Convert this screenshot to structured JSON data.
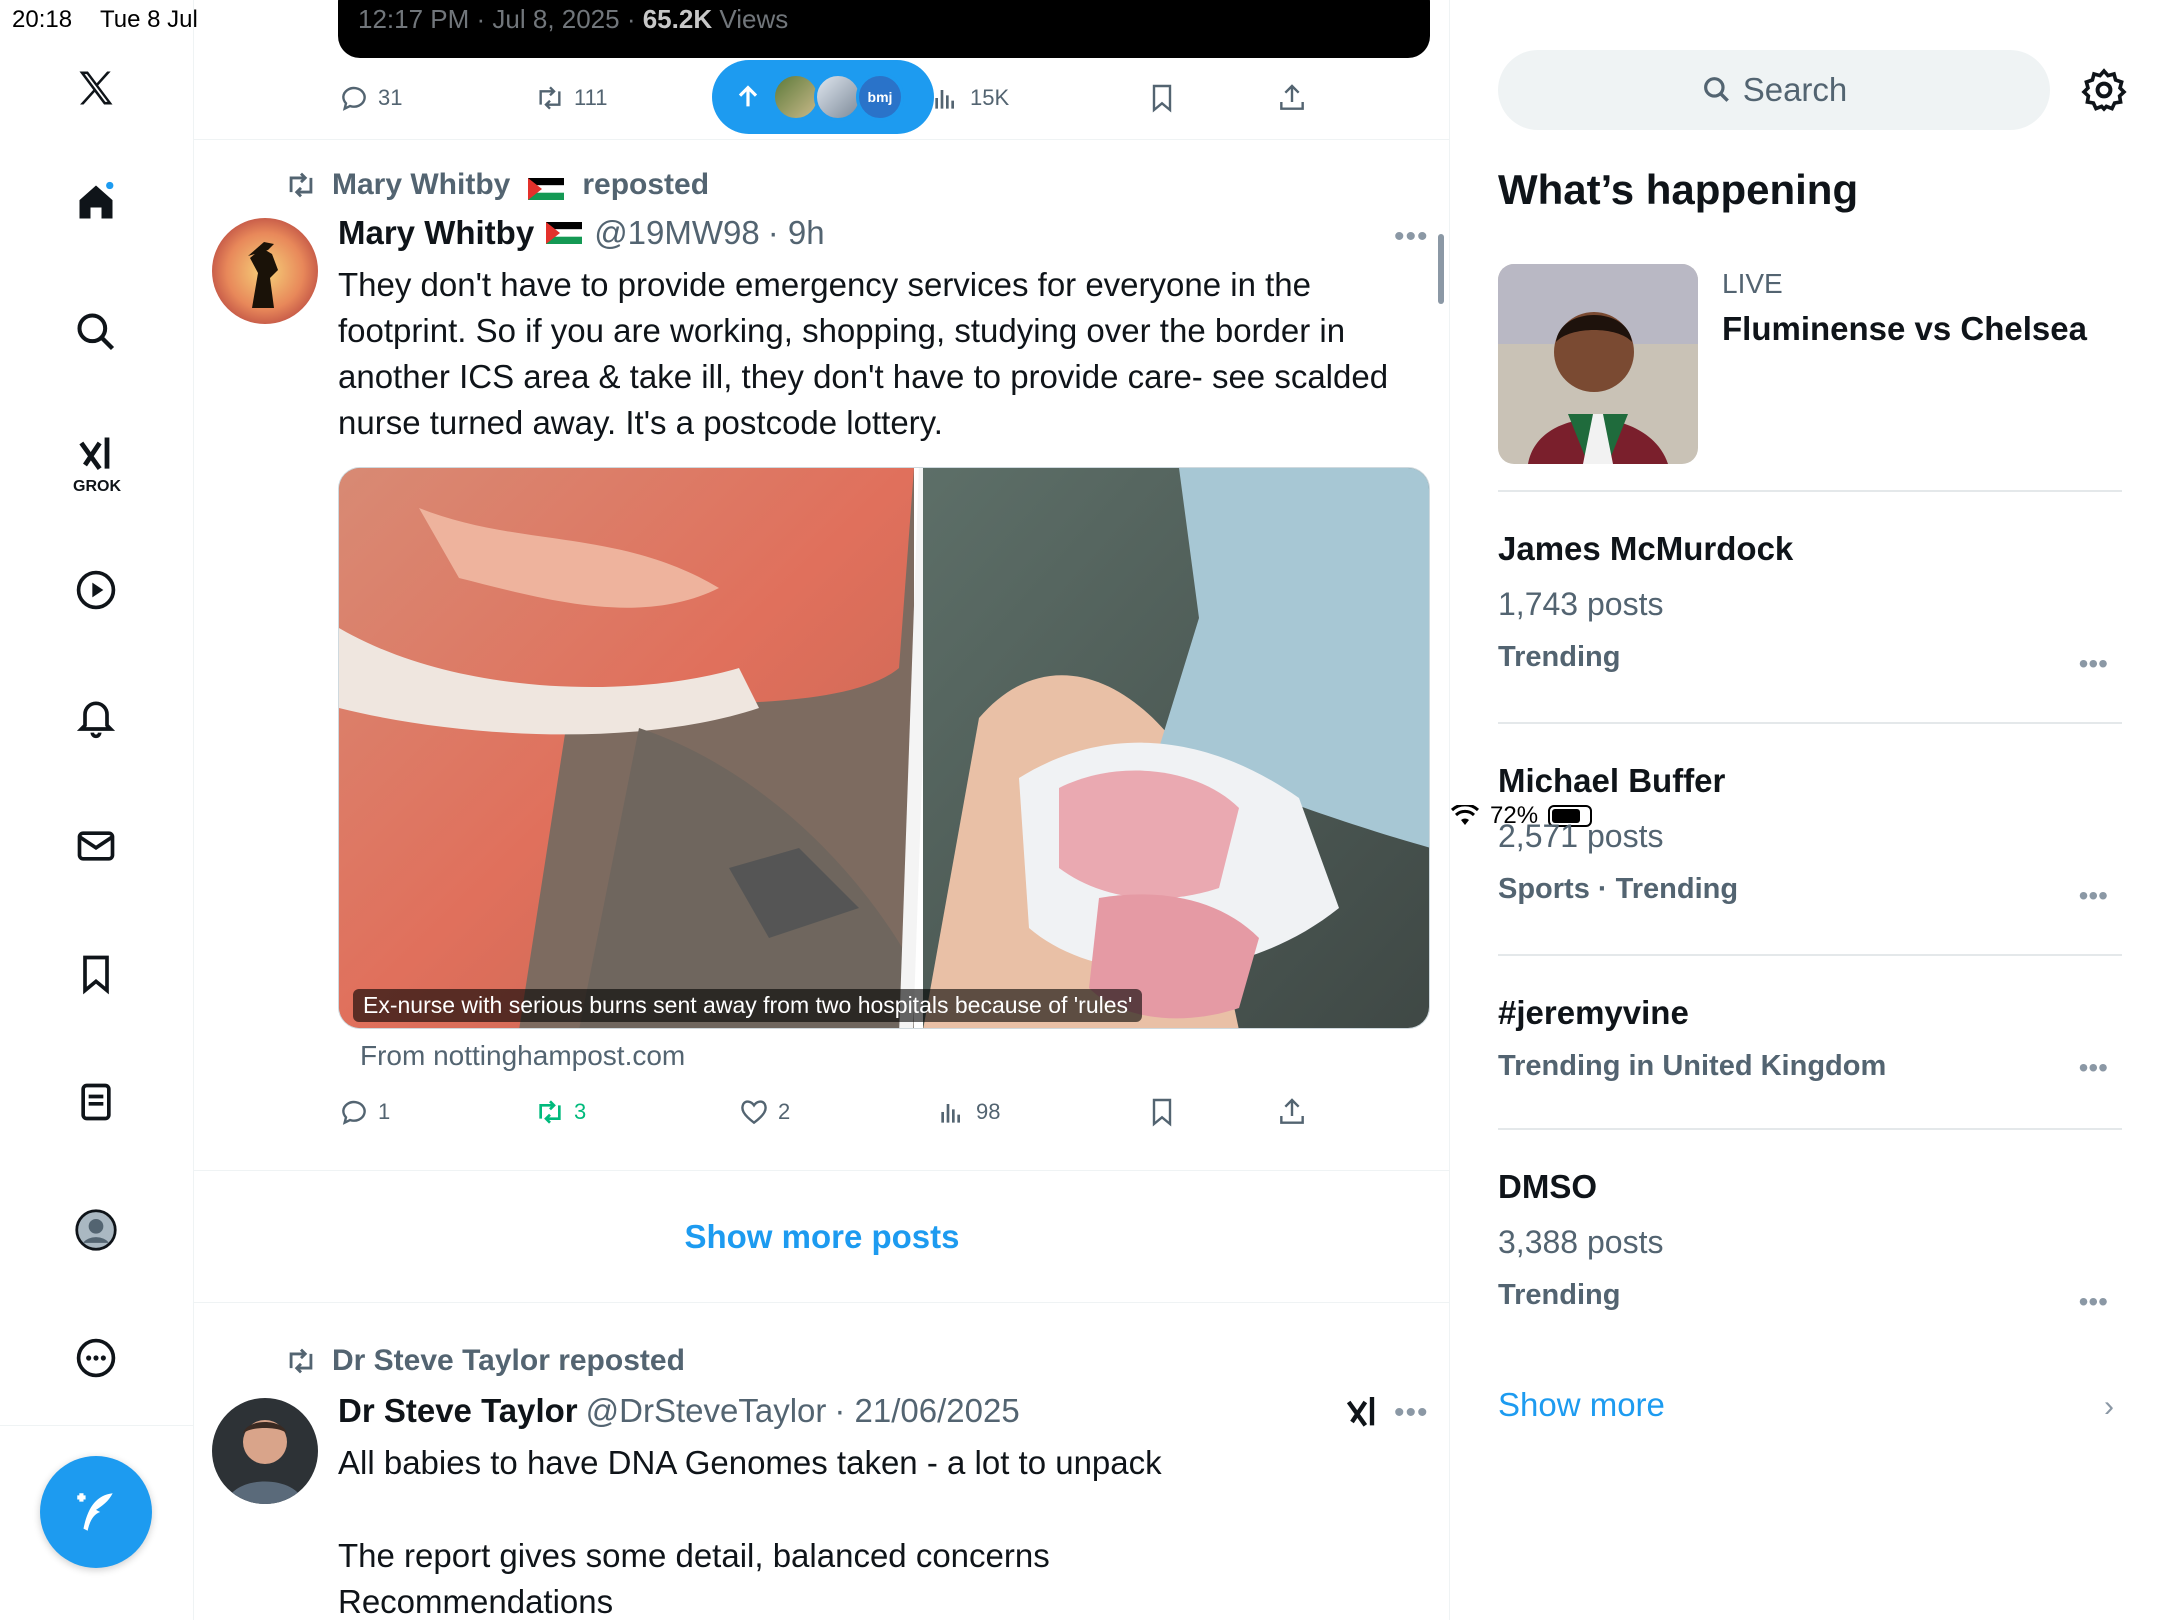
{
  "status_bar": {
    "time": "20:18",
    "date": "Tue 8 Jul",
    "battery": "72%"
  },
  "nav": {
    "grok_label": "GROK"
  },
  "top_card": {
    "time": "12:17 PM · Jul 8, 2025 · ",
    "views": "65.2K",
    "views_label": " Views"
  },
  "top_actions": {
    "replies": "31",
    "reposts": "111",
    "views": "15K"
  },
  "pill": {
    "badge": "bmj"
  },
  "tweet1": {
    "repost_label": "Mary Whitby",
    "repost_suffix": "reposted",
    "name": "Mary Whitby",
    "handle": "@19MW98",
    "time": "· 9h",
    "text": "They don't have to provide emergency services for everyone in the footprint. So if you are working, shopping, studying over the border in another ICS area & take ill, they don't have to provide care- see scalded nurse turned away. It's a postcode lottery.",
    "media_caption": "Ex-nurse with serious burns sent away from two hospitals because of 'rules'",
    "source": "From nottinghampost.com",
    "replies": "1",
    "reposts": "3",
    "likes": "2",
    "views": "98"
  },
  "show_more_posts": "Show more posts",
  "tweet2": {
    "repost_label": "Dr Steve Taylor reposted",
    "name": "Dr Steve Taylor",
    "handle": "@DrSteveTaylor",
    "time": "· 21/06/2025",
    "line1": "All babies to have DNA Genomes taken - a lot to unpack",
    "line2": "The report gives some detail, balanced concerns",
    "line3": "Recommendations"
  },
  "sidebar": {
    "search_placeholder": "Search",
    "title": "What’s happening",
    "live_tag": "LIVE",
    "live_title": "Fluminense vs Chelsea",
    "trends": [
      {
        "title": "James McMurdock",
        "posts": "1,743 posts",
        "category": "Trending"
      },
      {
        "title": "Michael Buffer",
        "posts": "2,571 posts",
        "category": "Sports · Trending"
      },
      {
        "title": "#jeremyvine",
        "posts": "",
        "category": "Trending in United Kingdom"
      },
      {
        "title": "DMSO",
        "posts": "3,388 posts",
        "category": "Trending"
      }
    ],
    "show_more": "Show more"
  },
  "colors": {
    "accent": "#1d9bf0",
    "repost_green": "#00ba7c",
    "muted": "#536471"
  }
}
